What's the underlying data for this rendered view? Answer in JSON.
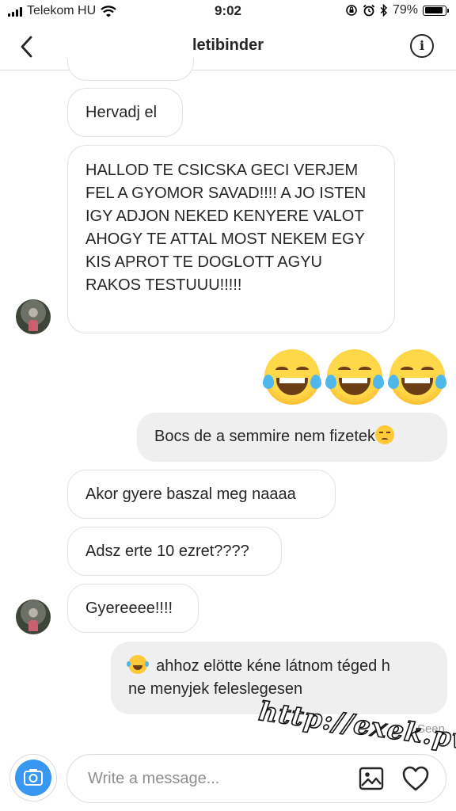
{
  "status_bar": {
    "carrier": "Telekom HU",
    "time": "9:02",
    "battery": "79%",
    "battery_level": 0.79
  },
  "header": {
    "title": "letibinder"
  },
  "messages": [
    {
      "from": "them",
      "text": "Hervadj el"
    },
    {
      "from": "them",
      "text": "HALLOD TE CSICSKA GECI VERJEM FEL A GYOMOR SAVAD!!!! A JO ISTEN IGY ADJON NEKED KENYERE VALOT AHOGY TE ATTAL MOST NEKEM EGY KIS APROT TE DOGLOTT AGYU RAKOS TESTUUU!!!!!"
    },
    {
      "from": "me",
      "emoji": [
        "face-with-tears-of-joy",
        "face-with-tears-of-joy",
        "face-with-tears-of-joy"
      ]
    },
    {
      "from": "me",
      "text": "Bocs de a semmire nem fizetek",
      "trailing_emoji": "pensive-face"
    },
    {
      "from": "them",
      "text": "Akor gyere baszal meg naaaa"
    },
    {
      "from": "them",
      "text": "Adsz erte 10 ezret????"
    },
    {
      "from": "them",
      "text": "Gyereeee!!!!"
    },
    {
      "from": "me",
      "leading_emoji": "face-with-tears-of-joy",
      "text_line1": "ahhoz elötte kéne látnom téged h",
      "text_line2": "ne menyjek feleslegesen"
    }
  ],
  "seen_label": "Seen",
  "watermark": "http://exek.pw",
  "composer": {
    "placeholder": "Write a message..."
  },
  "colors": {
    "accent": "#3897f0",
    "outgoing_bubble": "#efefef",
    "incoming_border": "#e2e2e2"
  }
}
